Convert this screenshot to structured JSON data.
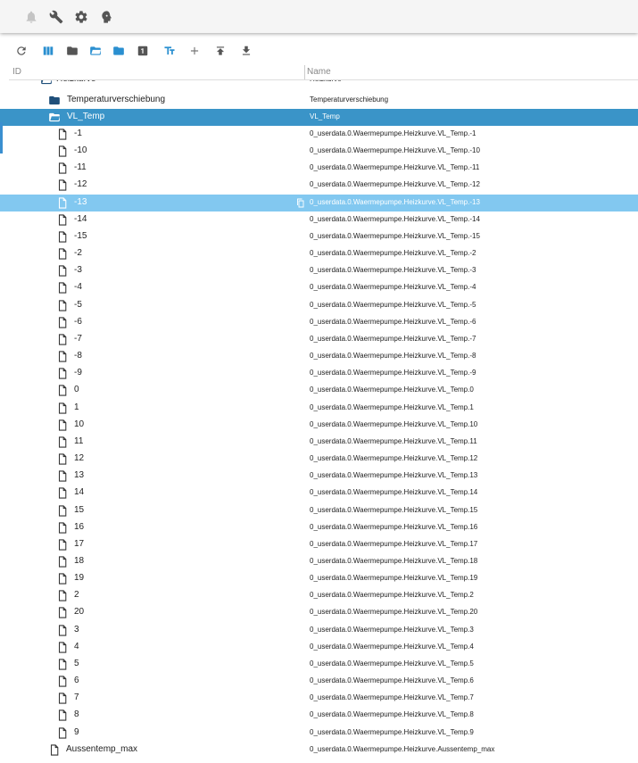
{
  "header": {
    "icons": [
      "bell-icon",
      "wrench-icon",
      "gear-icon",
      "head-icon"
    ]
  },
  "toolbar": {
    "icons": [
      "refresh-icon",
      "columns-icon",
      "folder-icon",
      "folder-open-icon",
      "folder-closed-icon",
      "number-1-icon",
      "text-icon",
      "plus-icon",
      "upload-icon",
      "download-icon"
    ]
  },
  "columns": {
    "id": "ID",
    "name": "Name"
  },
  "tree": {
    "parent": {
      "id": "Heizkurve",
      "name": "Heizkurve"
    },
    "folders": [
      {
        "id": "Temperaturverschiebung",
        "name": "Temperaturverschiebung"
      },
      {
        "id": "VL_Temp",
        "name": "VL_Temp"
      }
    ],
    "items": [
      {
        "id": "-1",
        "name": "0_userdata.0.Waermepumpe.Heizkurve.VL_Temp.-1"
      },
      {
        "id": "-10",
        "name": "0_userdata.0.Waermepumpe.Heizkurve.VL_Temp.-10"
      },
      {
        "id": "-11",
        "name": "0_userdata.0.Waermepumpe.Heizkurve.VL_Temp.-11"
      },
      {
        "id": "-12",
        "name": "0_userdata.0.Waermepumpe.Heizkurve.VL_Temp.-12"
      },
      {
        "id": "-13",
        "name": "0_userdata.0.Waermepumpe.Heizkurve.VL_Temp.-13"
      },
      {
        "id": "-14",
        "name": "0_userdata.0.Waermepumpe.Heizkurve.VL_Temp.-14"
      },
      {
        "id": "-15",
        "name": "0_userdata.0.Waermepumpe.Heizkurve.VL_Temp.-15"
      },
      {
        "id": "-2",
        "name": "0_userdata.0.Waermepumpe.Heizkurve.VL_Temp.-2"
      },
      {
        "id": "-3",
        "name": "0_userdata.0.Waermepumpe.Heizkurve.VL_Temp.-3"
      },
      {
        "id": "-4",
        "name": "0_userdata.0.Waermepumpe.Heizkurve.VL_Temp.-4"
      },
      {
        "id": "-5",
        "name": "0_userdata.0.Waermepumpe.Heizkurve.VL_Temp.-5"
      },
      {
        "id": "-6",
        "name": "0_userdata.0.Waermepumpe.Heizkurve.VL_Temp.-6"
      },
      {
        "id": "-7",
        "name": "0_userdata.0.Waermepumpe.Heizkurve.VL_Temp.-7"
      },
      {
        "id": "-8",
        "name": "0_userdata.0.Waermepumpe.Heizkurve.VL_Temp.-8"
      },
      {
        "id": "-9",
        "name": "0_userdata.0.Waermepumpe.Heizkurve.VL_Temp.-9"
      },
      {
        "id": "0",
        "name": "0_userdata.0.Waermepumpe.Heizkurve.VL_Temp.0"
      },
      {
        "id": "1",
        "name": "0_userdata.0.Waermepumpe.Heizkurve.VL_Temp.1"
      },
      {
        "id": "10",
        "name": "0_userdata.0.Waermepumpe.Heizkurve.VL_Temp.10"
      },
      {
        "id": "11",
        "name": "0_userdata.0.Waermepumpe.Heizkurve.VL_Temp.11"
      },
      {
        "id": "12",
        "name": "0_userdata.0.Waermepumpe.Heizkurve.VL_Temp.12"
      },
      {
        "id": "13",
        "name": "0_userdata.0.Waermepumpe.Heizkurve.VL_Temp.13"
      },
      {
        "id": "14",
        "name": "0_userdata.0.Waermepumpe.Heizkurve.VL_Temp.14"
      },
      {
        "id": "15",
        "name": "0_userdata.0.Waermepumpe.Heizkurve.VL_Temp.15"
      },
      {
        "id": "16",
        "name": "0_userdata.0.Waermepumpe.Heizkurve.VL_Temp.16"
      },
      {
        "id": "17",
        "name": "0_userdata.0.Waermepumpe.Heizkurve.VL_Temp.17"
      },
      {
        "id": "18",
        "name": "0_userdata.0.Waermepumpe.Heizkurve.VL_Temp.18"
      },
      {
        "id": "19",
        "name": "0_userdata.0.Waermepumpe.Heizkurve.VL_Temp.19"
      },
      {
        "id": "2",
        "name": "0_userdata.0.Waermepumpe.Heizkurve.VL_Temp.2"
      },
      {
        "id": "20",
        "name": "0_userdata.0.Waermepumpe.Heizkurve.VL_Temp.20"
      },
      {
        "id": "3",
        "name": "0_userdata.0.Waermepumpe.Heizkurve.VL_Temp.3"
      },
      {
        "id": "4",
        "name": "0_userdata.0.Waermepumpe.Heizkurve.VL_Temp.4"
      },
      {
        "id": "5",
        "name": "0_userdata.0.Waermepumpe.Heizkurve.VL_Temp.5"
      },
      {
        "id": "6",
        "name": "0_userdata.0.Waermepumpe.Heizkurve.VL_Temp.6"
      },
      {
        "id": "7",
        "name": "0_userdata.0.Waermepumpe.Heizkurve.VL_Temp.7"
      },
      {
        "id": "8",
        "name": "0_userdata.0.Waermepumpe.Heizkurve.VL_Temp.8"
      },
      {
        "id": "9",
        "name": "0_userdata.0.Waermepumpe.Heizkurve.VL_Temp.9"
      }
    ],
    "sibling": {
      "id": "Aussentemp_max",
      "name": "0_userdata.0.Waermepumpe.Heizkurve.Aussentemp_max"
    }
  },
  "colors": {
    "selected_row": "#3a94c8",
    "hover_row": "#82c8f0",
    "accent": "#2a8fd0",
    "folder": "#1f4f7a"
  }
}
